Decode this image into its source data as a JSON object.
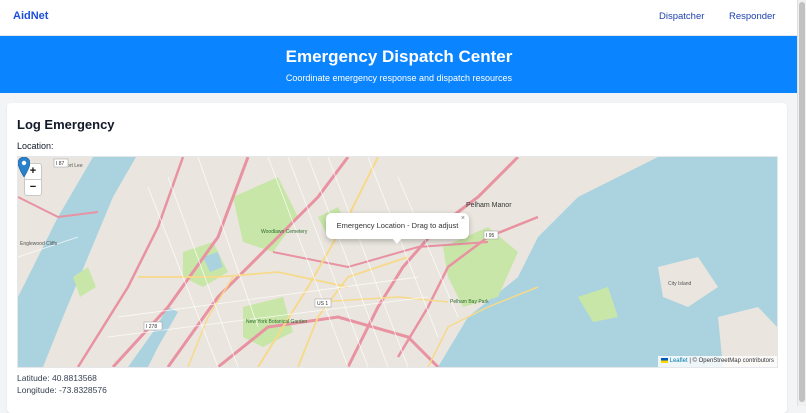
{
  "nav": {
    "brand": "AidNet",
    "links": [
      "Dispatcher",
      "Responder"
    ]
  },
  "hero": {
    "title": "Emergency Dispatch Center",
    "subtitle": "Coordinate emergency response and dispatch resources"
  },
  "form": {
    "heading": "Log Emergency",
    "location_label": "Location:"
  },
  "map": {
    "zoom_in": "+",
    "zoom_out": "−",
    "popup_text": "Emergency Location - Drag to adjust",
    "popup_close": "×",
    "attribution_leaflet": "Leaflet",
    "attribution_osm": "| © OpenStreetMap contributors",
    "labels": [
      "Pelham Manor",
      "Woodlawn Cemetery",
      "Englewood Cliffs",
      "Fort Lee",
      "New York Botanical Garden",
      "Pelham Bay Park",
      "City Island"
    ],
    "road_shields": [
      "I 95",
      "US 1",
      "I 87",
      "I 278"
    ],
    "colors": {
      "water": "#aad3df",
      "park": "#c8e6a8",
      "land": "#eae6df",
      "highway": "#e892a2",
      "arterial": "#f7d98a"
    }
  },
  "coords": {
    "latitude": "Latitude: 40.8813568",
    "longitude": "Longitude: -73.8328576"
  }
}
